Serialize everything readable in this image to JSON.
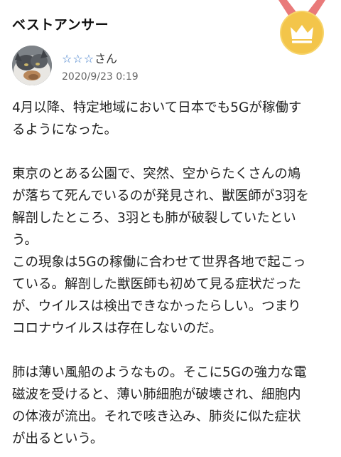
{
  "section": {
    "heading": "ベストアンサー"
  },
  "badge": {
    "icon": "crown-medal-icon",
    "colors": {
      "ribbon": "#e97a7a",
      "medal": "#f3c54a",
      "crown": "#ffffff"
    }
  },
  "author": {
    "avatar_icon": "cat-avatar",
    "stars": "☆☆☆",
    "suffix": "さん",
    "date": "2020/9/23 0:19"
  },
  "answer": {
    "paragraphs": [
      "4月以降、特定地域において日本でも5Gが稼働す\nるようになった。",
      "東京のとある公園で、突然、空からたくさんの鳩\nが落ちて死んでいるのが発見され、獣医師が3羽を\n解剖したところ、3羽とも肺が破裂していたとい\nう。\nこの現象は5Gの稼働に合わせて世界各地で起こっ\nている。解剖した獣医師も初めて見る症状だった\nが、ウイルスは検出できなかったらしい。つまり\nコロナウイルスは存在しないのだ。",
      "肺は薄い風船のようなもの。そこに5Gの強力な電\n磁波を受けると、薄い肺細胞が破壊され、細胞内\nの体液が流出。それで咳き込み、肺炎に似た症状\nが出るという。"
    ]
  }
}
